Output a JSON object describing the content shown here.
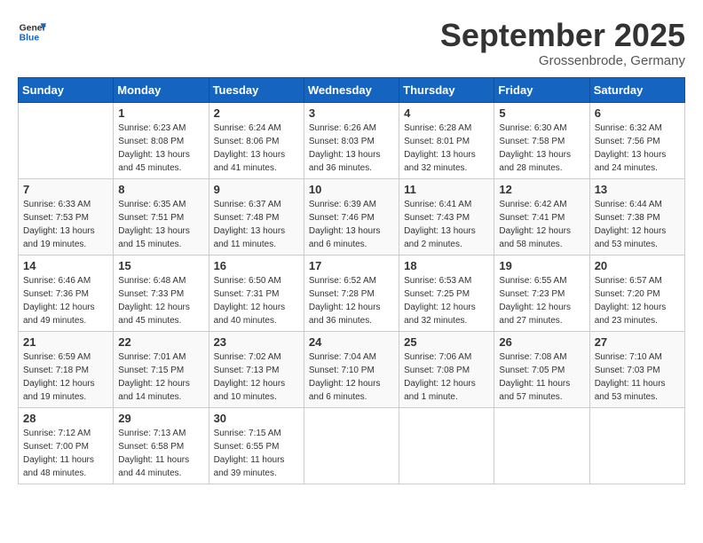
{
  "header": {
    "logo_general": "General",
    "logo_blue": "Blue",
    "month_title": "September 2025",
    "location": "Grossenbrode, Germany"
  },
  "days_of_week": [
    "Sunday",
    "Monday",
    "Tuesday",
    "Wednesday",
    "Thursday",
    "Friday",
    "Saturday"
  ],
  "weeks": [
    [
      {
        "day": "",
        "info": []
      },
      {
        "day": "1",
        "info": [
          "Sunrise: 6:23 AM",
          "Sunset: 8:08 PM",
          "Daylight: 13 hours",
          "and 45 minutes."
        ]
      },
      {
        "day": "2",
        "info": [
          "Sunrise: 6:24 AM",
          "Sunset: 8:06 PM",
          "Daylight: 13 hours",
          "and 41 minutes."
        ]
      },
      {
        "day": "3",
        "info": [
          "Sunrise: 6:26 AM",
          "Sunset: 8:03 PM",
          "Daylight: 13 hours",
          "and 36 minutes."
        ]
      },
      {
        "day": "4",
        "info": [
          "Sunrise: 6:28 AM",
          "Sunset: 8:01 PM",
          "Daylight: 13 hours",
          "and 32 minutes."
        ]
      },
      {
        "day": "5",
        "info": [
          "Sunrise: 6:30 AM",
          "Sunset: 7:58 PM",
          "Daylight: 13 hours",
          "and 28 minutes."
        ]
      },
      {
        "day": "6",
        "info": [
          "Sunrise: 6:32 AM",
          "Sunset: 7:56 PM",
          "Daylight: 13 hours",
          "and 24 minutes."
        ]
      }
    ],
    [
      {
        "day": "7",
        "info": [
          "Sunrise: 6:33 AM",
          "Sunset: 7:53 PM",
          "Daylight: 13 hours",
          "and 19 minutes."
        ]
      },
      {
        "day": "8",
        "info": [
          "Sunrise: 6:35 AM",
          "Sunset: 7:51 PM",
          "Daylight: 13 hours",
          "and 15 minutes."
        ]
      },
      {
        "day": "9",
        "info": [
          "Sunrise: 6:37 AM",
          "Sunset: 7:48 PM",
          "Daylight: 13 hours",
          "and 11 minutes."
        ]
      },
      {
        "day": "10",
        "info": [
          "Sunrise: 6:39 AM",
          "Sunset: 7:46 PM",
          "Daylight: 13 hours",
          "and 6 minutes."
        ]
      },
      {
        "day": "11",
        "info": [
          "Sunrise: 6:41 AM",
          "Sunset: 7:43 PM",
          "Daylight: 13 hours",
          "and 2 minutes."
        ]
      },
      {
        "day": "12",
        "info": [
          "Sunrise: 6:42 AM",
          "Sunset: 7:41 PM",
          "Daylight: 12 hours",
          "and 58 minutes."
        ]
      },
      {
        "day": "13",
        "info": [
          "Sunrise: 6:44 AM",
          "Sunset: 7:38 PM",
          "Daylight: 12 hours",
          "and 53 minutes."
        ]
      }
    ],
    [
      {
        "day": "14",
        "info": [
          "Sunrise: 6:46 AM",
          "Sunset: 7:36 PM",
          "Daylight: 12 hours",
          "and 49 minutes."
        ]
      },
      {
        "day": "15",
        "info": [
          "Sunrise: 6:48 AM",
          "Sunset: 7:33 PM",
          "Daylight: 12 hours",
          "and 45 minutes."
        ]
      },
      {
        "day": "16",
        "info": [
          "Sunrise: 6:50 AM",
          "Sunset: 7:31 PM",
          "Daylight: 12 hours",
          "and 40 minutes."
        ]
      },
      {
        "day": "17",
        "info": [
          "Sunrise: 6:52 AM",
          "Sunset: 7:28 PM",
          "Daylight: 12 hours",
          "and 36 minutes."
        ]
      },
      {
        "day": "18",
        "info": [
          "Sunrise: 6:53 AM",
          "Sunset: 7:25 PM",
          "Daylight: 12 hours",
          "and 32 minutes."
        ]
      },
      {
        "day": "19",
        "info": [
          "Sunrise: 6:55 AM",
          "Sunset: 7:23 PM",
          "Daylight: 12 hours",
          "and 27 minutes."
        ]
      },
      {
        "day": "20",
        "info": [
          "Sunrise: 6:57 AM",
          "Sunset: 7:20 PM",
          "Daylight: 12 hours",
          "and 23 minutes."
        ]
      }
    ],
    [
      {
        "day": "21",
        "info": [
          "Sunrise: 6:59 AM",
          "Sunset: 7:18 PM",
          "Daylight: 12 hours",
          "and 19 minutes."
        ]
      },
      {
        "day": "22",
        "info": [
          "Sunrise: 7:01 AM",
          "Sunset: 7:15 PM",
          "Daylight: 12 hours",
          "and 14 minutes."
        ]
      },
      {
        "day": "23",
        "info": [
          "Sunrise: 7:02 AM",
          "Sunset: 7:13 PM",
          "Daylight: 12 hours",
          "and 10 minutes."
        ]
      },
      {
        "day": "24",
        "info": [
          "Sunrise: 7:04 AM",
          "Sunset: 7:10 PM",
          "Daylight: 12 hours",
          "and 6 minutes."
        ]
      },
      {
        "day": "25",
        "info": [
          "Sunrise: 7:06 AM",
          "Sunset: 7:08 PM",
          "Daylight: 12 hours",
          "and 1 minute."
        ]
      },
      {
        "day": "26",
        "info": [
          "Sunrise: 7:08 AM",
          "Sunset: 7:05 PM",
          "Daylight: 11 hours",
          "and 57 minutes."
        ]
      },
      {
        "day": "27",
        "info": [
          "Sunrise: 7:10 AM",
          "Sunset: 7:03 PM",
          "Daylight: 11 hours",
          "and 53 minutes."
        ]
      }
    ],
    [
      {
        "day": "28",
        "info": [
          "Sunrise: 7:12 AM",
          "Sunset: 7:00 PM",
          "Daylight: 11 hours",
          "and 48 minutes."
        ]
      },
      {
        "day": "29",
        "info": [
          "Sunrise: 7:13 AM",
          "Sunset: 6:58 PM",
          "Daylight: 11 hours",
          "and 44 minutes."
        ]
      },
      {
        "day": "30",
        "info": [
          "Sunrise: 7:15 AM",
          "Sunset: 6:55 PM",
          "Daylight: 11 hours",
          "and 39 minutes."
        ]
      },
      {
        "day": "",
        "info": []
      },
      {
        "day": "",
        "info": []
      },
      {
        "day": "",
        "info": []
      },
      {
        "day": "",
        "info": []
      }
    ]
  ]
}
